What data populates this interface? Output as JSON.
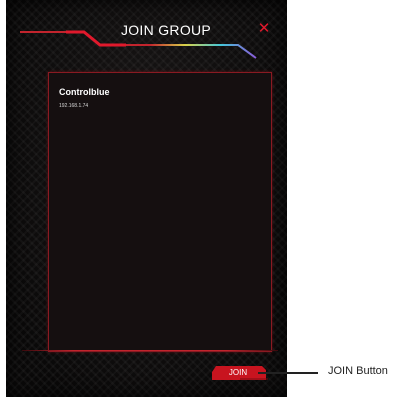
{
  "dialog": {
    "title": "JOIN GROUP",
    "close_icon": "close-icon"
  },
  "groups": [
    {
      "name": "Controlblue",
      "ip": "192.168.1.74"
    }
  ],
  "footer": {
    "join_label": "JOIN"
  },
  "annotation": {
    "label": "JOIN Button"
  },
  "colors": {
    "accent": "#e0192c",
    "panel_border": "#8a1a22",
    "background": "#0e0d0e"
  }
}
